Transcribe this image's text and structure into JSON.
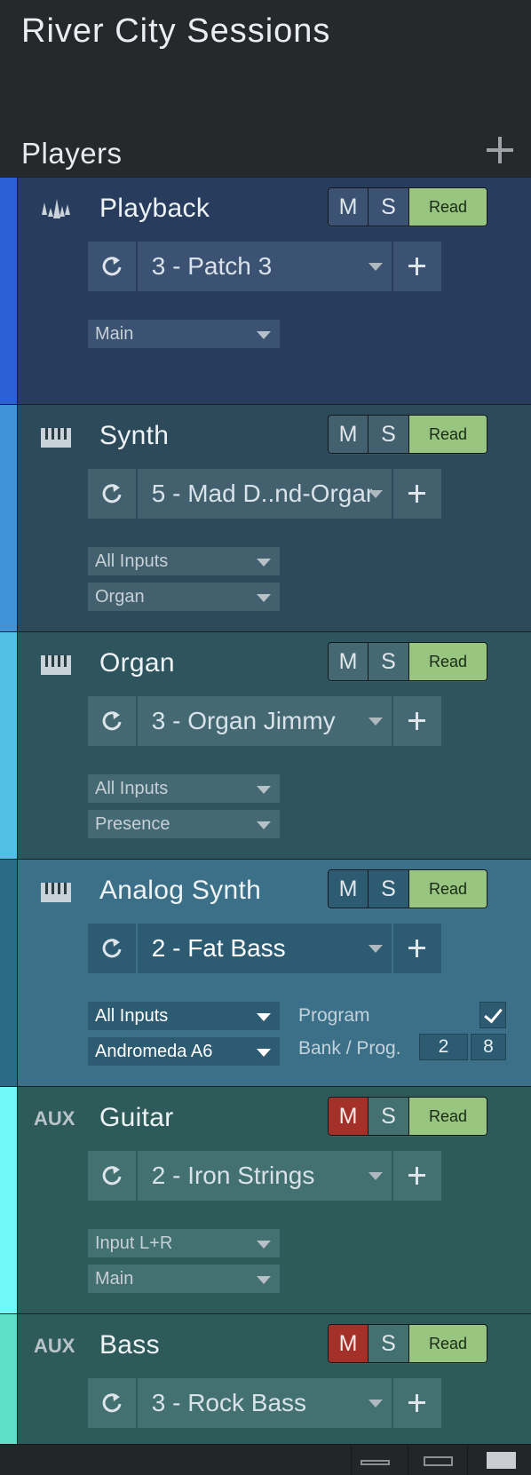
{
  "app": {
    "title": "River City Sessions"
  },
  "section": {
    "title": "Players"
  },
  "icons": {
    "add": "plus-icon",
    "cycle": "cycle-arrow-icon",
    "dropdown": "chevron-down-icon"
  },
  "buttons": {
    "mute": "M",
    "solo": "S",
    "automation": "Read"
  },
  "tracks": [
    {
      "name": "Playback",
      "icon": "waveform-icon",
      "icon_text": "",
      "stripe_color": "#2a5fd8",
      "bg_color": "#283d5e",
      "ctrl_color": "#3b5272",
      "mute_active": false,
      "patch": "3 - Patch 3",
      "selects": [
        "Main"
      ]
    },
    {
      "name": "Synth",
      "icon": "keyboard-icon",
      "icon_text": "",
      "stripe_color": "#3f93d6",
      "bg_color": "#2d4a5a",
      "ctrl_color": "#43606f",
      "mute_active": false,
      "patch": "5 - Mad D..nd-Organ",
      "selects": [
        "All Inputs",
        "Organ"
      ]
    },
    {
      "name": "Organ",
      "icon": "keyboard-icon",
      "icon_text": "",
      "stripe_color": "#52bfe6",
      "bg_color": "#2e545e",
      "ctrl_color": "#446972",
      "mute_active": false,
      "patch": "3 - Organ Jimmy",
      "selects": [
        "All Inputs",
        "Presence"
      ]
    },
    {
      "name": "Analog Synth",
      "icon": "keyboard-icon",
      "icon_text": "",
      "stripe_color": "#2b6a86",
      "bg_color": "#3b7088",
      "ctrl_color": "#2c5b72",
      "mute_active": false,
      "selected": true,
      "patch": "2 - Fat Bass",
      "selects": [
        "All Inputs",
        "Andromeda A6"
      ],
      "program_label": "Program",
      "program_checked": true,
      "bank_label": "Bank / Prog.",
      "bank": "2",
      "prog": "8"
    },
    {
      "name": "Guitar",
      "icon": "aux-icon",
      "icon_text": "AUX",
      "stripe_color": "#6ef8f8",
      "bg_color": "#2e5a5a",
      "ctrl_color": "#437070",
      "mute_active": true,
      "patch": "2 - Iron Strings",
      "selects": [
        "Input L+R",
        "Main"
      ]
    },
    {
      "name": "Bass",
      "icon": "aux-icon",
      "icon_text": "AUX",
      "stripe_color": "#5ee0c8",
      "bg_color": "#2e5a5a",
      "ctrl_color": "#437070",
      "mute_active": true,
      "patch": "3 - Rock Bass",
      "selects": []
    }
  ],
  "view_modes": [
    "small-view-icon",
    "medium-view-icon",
    "large-view-icon"
  ]
}
